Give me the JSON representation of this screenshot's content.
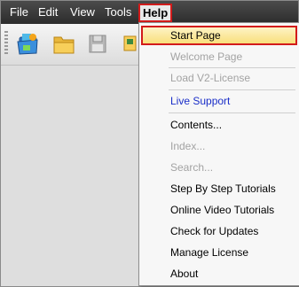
{
  "menubar": {
    "items": [
      {
        "label": "File"
      },
      {
        "label": "Edit"
      },
      {
        "label": "View"
      },
      {
        "label": "Tools"
      },
      {
        "label": "Help"
      }
    ]
  },
  "toolbar": {
    "buttons": [
      {
        "icon": "open-project-icon"
      },
      {
        "icon": "folder-icon"
      },
      {
        "icon": "save-icon"
      }
    ]
  },
  "help_menu": {
    "items": [
      {
        "label": "Start Page",
        "state": "highlighted"
      },
      {
        "label": "Welcome Page",
        "state": "disabled"
      },
      {
        "label": "Load V2-License",
        "state": "disabled"
      },
      {
        "label": "Live Support",
        "state": "link"
      },
      {
        "label": "Contents...",
        "state": "normal"
      },
      {
        "label": "Index...",
        "state": "disabled"
      },
      {
        "label": "Search...",
        "state": "disabled"
      },
      {
        "label": "Step By Step Tutorials",
        "state": "normal"
      },
      {
        "label": "Online Video Tutorials",
        "state": "normal"
      },
      {
        "label": "Check for Updates",
        "state": "normal"
      },
      {
        "label": "Manage License",
        "state": "normal"
      },
      {
        "label": "About",
        "state": "normal"
      }
    ]
  },
  "colors": {
    "highlight_border": "#d21b1b",
    "highlight_fill": "#f9df7b",
    "link": "#1a2ec8",
    "disabled_text": "#a3a3a3"
  }
}
